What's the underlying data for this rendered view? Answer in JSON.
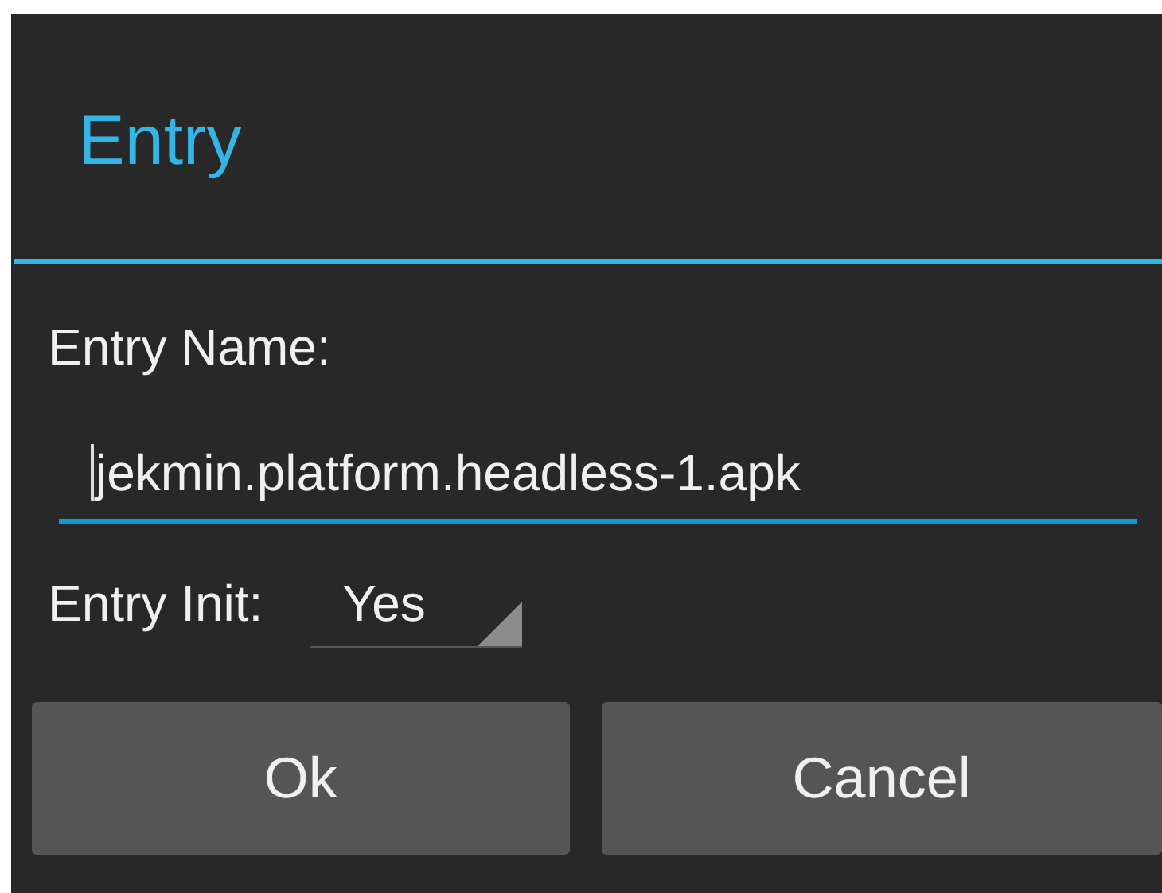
{
  "dialog": {
    "title": "Entry"
  },
  "name_field": {
    "label": "Entry Name:",
    "value": "jekmin.platform.headless-1.apk",
    "focused": true
  },
  "init_field": {
    "label": "Entry Init:",
    "value": "Yes"
  },
  "buttons": [
    "Ok",
    "Cancel"
  ]
}
